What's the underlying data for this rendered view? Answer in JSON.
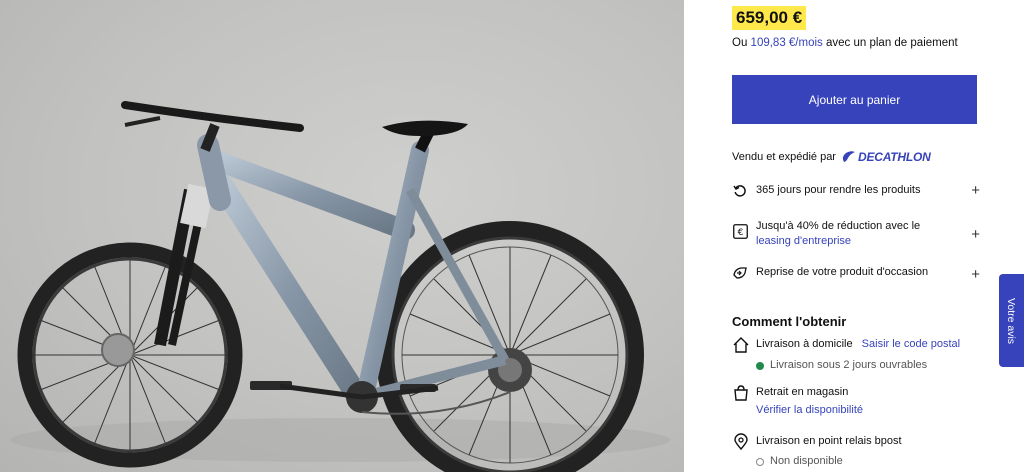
{
  "product": {
    "price": "659,00 €",
    "payment_prefix": "Ou",
    "payment_amount": "109,83 €/mois",
    "payment_suffix": "avec un plan de paiement",
    "add_to_cart_label": "Ajouter au panier"
  },
  "seller": {
    "text": "Vendu et expédié par",
    "brand": "DECATHLON"
  },
  "benefits": [
    {
      "icon": "return-icon",
      "text": "365 jours pour rendre les produits"
    },
    {
      "icon": "euro-icon",
      "text": "Jusqu'à 40% de réduction avec le",
      "link": "leasing d'entreprise"
    },
    {
      "icon": "trade-in-icon",
      "text": "Reprise de votre produit d'occasion"
    }
  ],
  "delivery": {
    "title": "Comment l'obtenir",
    "home": {
      "label": "Livraison à domicile",
      "action": "Saisir le code postal",
      "status": "Livraison sous 2 jours ouvrables",
      "status_color": "#1f8a4c"
    },
    "store": {
      "label": "Retrait en magasin",
      "action": "Vérifier la disponibilité"
    },
    "relay": {
      "label": "Livraison en point relais bpost",
      "status": "Non disponible"
    }
  },
  "feedback_tab": "Votre avis",
  "colors": {
    "accent": "#3643ba",
    "price_bg": "#ffe94a"
  }
}
